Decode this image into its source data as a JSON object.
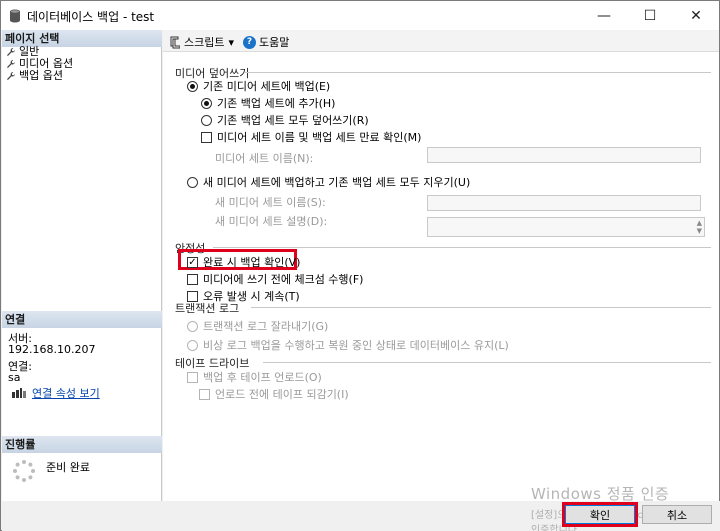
{
  "window": {
    "title": "데이터베이스 백업 - test",
    "min_glyph": "—",
    "max_glyph": "☐",
    "close_glyph": "✕"
  },
  "left": {
    "page_select_header": "페이지 선택",
    "nav_items": [
      "일반",
      "미디어 옵션",
      "백업 옵션"
    ],
    "connection_header": "연결",
    "server_label": "서버:",
    "server_value": "192.168.10.207",
    "conn_label": "연결:",
    "conn_value": "sa",
    "conn_props_link": "연결 속성 보기",
    "progress_header": "진행률",
    "progress_status": "준비 완료"
  },
  "toolbar": {
    "script_label": "스크립트",
    "script_dropdown": "▾",
    "help_glyph": "?",
    "help_label": "도움말"
  },
  "media_overwrite": {
    "title": "미디어 덮어쓰기",
    "existing_set": "기존 미디어 세트에 백업(E)",
    "append": "기존 백업 세트에 추가(H)",
    "overwrite_all": "기존 백업 세트 모두 덮어쓰기(R)",
    "check_name_expiry": "미디어 세트 이름 및 백업 세트 만료 확인(M)",
    "media_set_name_label": "미디어 세트 이름(N):",
    "new_set": "새 미디어 세트에 백업하고 기존 백업 세트 모두 지우기(U)",
    "new_set_name_label": "새 미디어 세트 이름(S):",
    "new_set_desc_label": "새 미디어 세트 설명(D):",
    "spin_up": "▲",
    "spin_down": "▼"
  },
  "reliability": {
    "title": "안정성",
    "verify": "완료 시 백업 확인(V)",
    "checksum": "미디어에 쓰기 전에 체크섬 수행(F)",
    "continue_on_error": "오류 발생 시 계속(T)"
  },
  "transaction_log": {
    "title": "트랜잭션 로그",
    "truncate": "트랜잭션 로그 잘라내기(G)",
    "tail_log": "비상 로그 백업을 수행하고 복원 중인 상태로 데이터베이스 유지(L)"
  },
  "tape_drive": {
    "title": "테이프 드라이브",
    "unload": "백업 후 테이프 언로드(O)",
    "rewind": "언로드 전에 테이프 되감기(I)"
  },
  "buttons": {
    "ok": "확인",
    "cancel": "취소"
  },
  "watermark": {
    "line1": "Windows 정품 인증",
    "line2": "[설정]으로 이동하여 Windows를 정",
    "line3": "인증합니다."
  },
  "state": {
    "existing_set_checked": true,
    "append_checked": true,
    "verify_checked": true
  },
  "colors": {
    "highlight": "#e0001b",
    "link": "#0645ad",
    "help_icon": "#1a73c9"
  }
}
